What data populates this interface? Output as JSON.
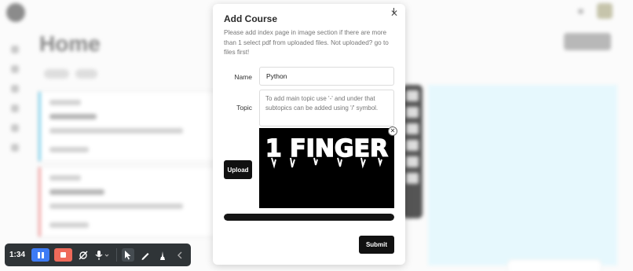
{
  "modal": {
    "title": "Add Course",
    "description": "Please add index page in image section if there are more than 1 select pdf from uploaded files. Not uploaded? go to files first!",
    "close_icon": "close-icon",
    "name": {
      "label": "Name",
      "value": "Python"
    },
    "topic": {
      "label": "Topic",
      "placeholder": "To add main topic use '-' and under that subtopics can be added using '/' symbol."
    },
    "upload": {
      "button_label": "Upload",
      "preview_text": "1 FINGER",
      "preview_remove_icon": "close-circle-icon"
    },
    "progress": {
      "fraction": 1.0
    },
    "submit_label": "Submit"
  },
  "background": {
    "page_title": "Home"
  },
  "recorder": {
    "time": "1:34",
    "icons": [
      "pause-icon",
      "stop-icon",
      "camera-off-icon",
      "microphone-icon",
      "pointer-icon",
      "pen-icon",
      "highlighter-icon",
      "collapse-chevron-icon"
    ],
    "colors": {
      "toolbar": "#2f3437",
      "pause": "#3d7bf5",
      "stop": "#ef6a5a"
    }
  },
  "colors": {
    "primary_button": "#111111",
    "right_panel": "#e6f8fd"
  }
}
